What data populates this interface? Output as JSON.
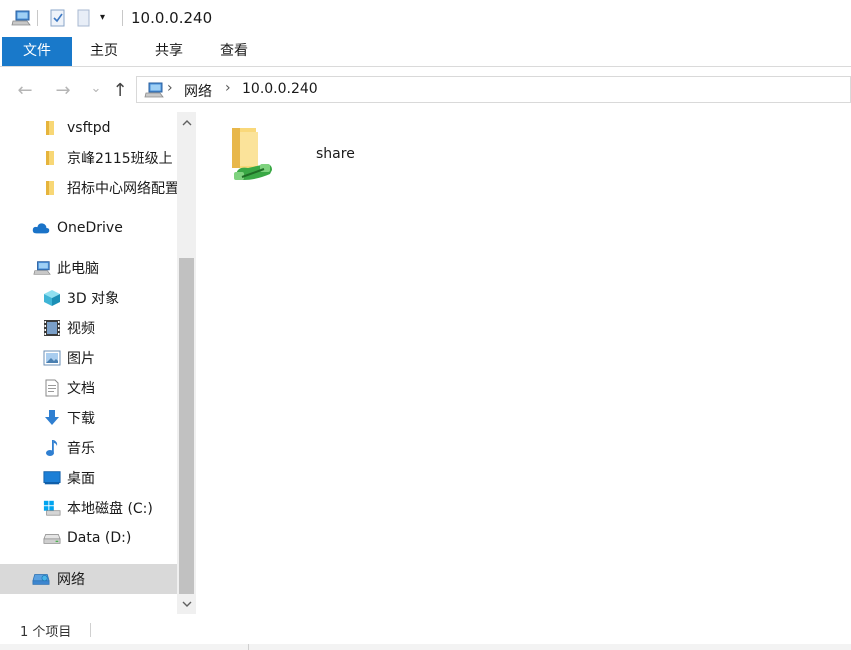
{
  "window": {
    "title": "10.0.0.240",
    "quick_access": {
      "computer_icon": "computer-icon",
      "properties_icon": "properties-check-icon",
      "new_folder_icon": "new-folder-icon",
      "dropdown_glyph": "▾"
    }
  },
  "ribbon": {
    "tabs": [
      {
        "label": "文件",
        "name": "tab-file"
      },
      {
        "label": "主页",
        "name": "tab-home"
      },
      {
        "label": "共享",
        "name": "tab-share"
      },
      {
        "label": "查看",
        "name": "tab-view"
      }
    ],
    "accent": "#1979ca"
  },
  "navigation": {
    "back": "←",
    "forward": "→",
    "recent": "⌄",
    "up": "↑",
    "breadcrumb": [
      "网络",
      "10.0.0.240"
    ],
    "crumb_sep": "›"
  },
  "navpane": {
    "items": [
      {
        "label": "vsftpd",
        "icon": "folder-icon"
      },
      {
        "label": "京峰2115班级上",
        "icon": "folder-icon"
      },
      {
        "label": "招标中心网络配置",
        "icon": "folder-icon"
      },
      {
        "label": "OneDrive",
        "icon": "onedrive-cloud-icon"
      },
      {
        "label": "此电脑",
        "icon": "this-pc-icon"
      },
      {
        "label": "3D 对象",
        "icon": "3d-objects-icon"
      },
      {
        "label": "视频",
        "icon": "video-icon"
      },
      {
        "label": "图片",
        "icon": "pictures-icon"
      },
      {
        "label": "文档",
        "icon": "documents-icon"
      },
      {
        "label": "下载",
        "icon": "downloads-icon"
      },
      {
        "label": "音乐",
        "icon": "music-icon"
      },
      {
        "label": "桌面",
        "icon": "desktop-icon"
      },
      {
        "label": "本地磁盘 (C:)",
        "icon": "local-disk-c-icon"
      },
      {
        "label": "Data (D:)",
        "icon": "drive-d-icon"
      },
      {
        "label": "网络",
        "icon": "network-icon"
      }
    ],
    "selected": "网络"
  },
  "content": {
    "items": [
      {
        "label": "share",
        "icon": "shared-folder-icon"
      }
    ]
  },
  "status": {
    "item_count": "1 个项目"
  }
}
